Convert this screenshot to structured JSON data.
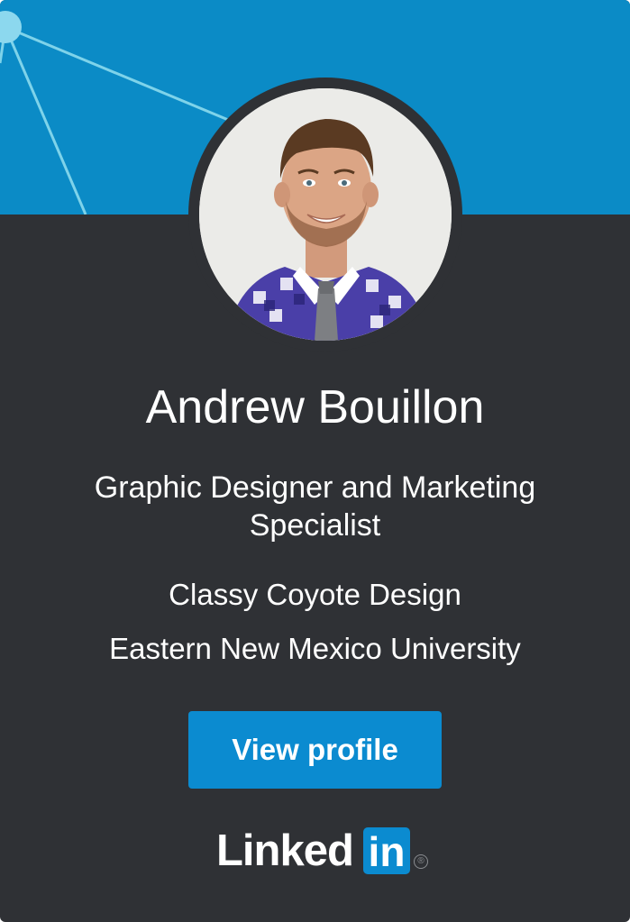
{
  "profile": {
    "name": "Andrew Bouillon",
    "headline": "Graphic Designer and Marketing Specialist",
    "company": "Classy Coyote Design",
    "school": "Eastern New Mexico University"
  },
  "actions": {
    "view_profile_label": "View profile"
  },
  "brand": {
    "wordmark": "Linked",
    "badge": "in",
    "registered": "®"
  },
  "colors": {
    "banner": "#0b8bc6",
    "card_background": "#2f3135",
    "button": "#0b8bd0",
    "text": "#ffffff"
  },
  "icons": {
    "avatar": "profile-photo",
    "banner_graphic": "network-nodes"
  }
}
